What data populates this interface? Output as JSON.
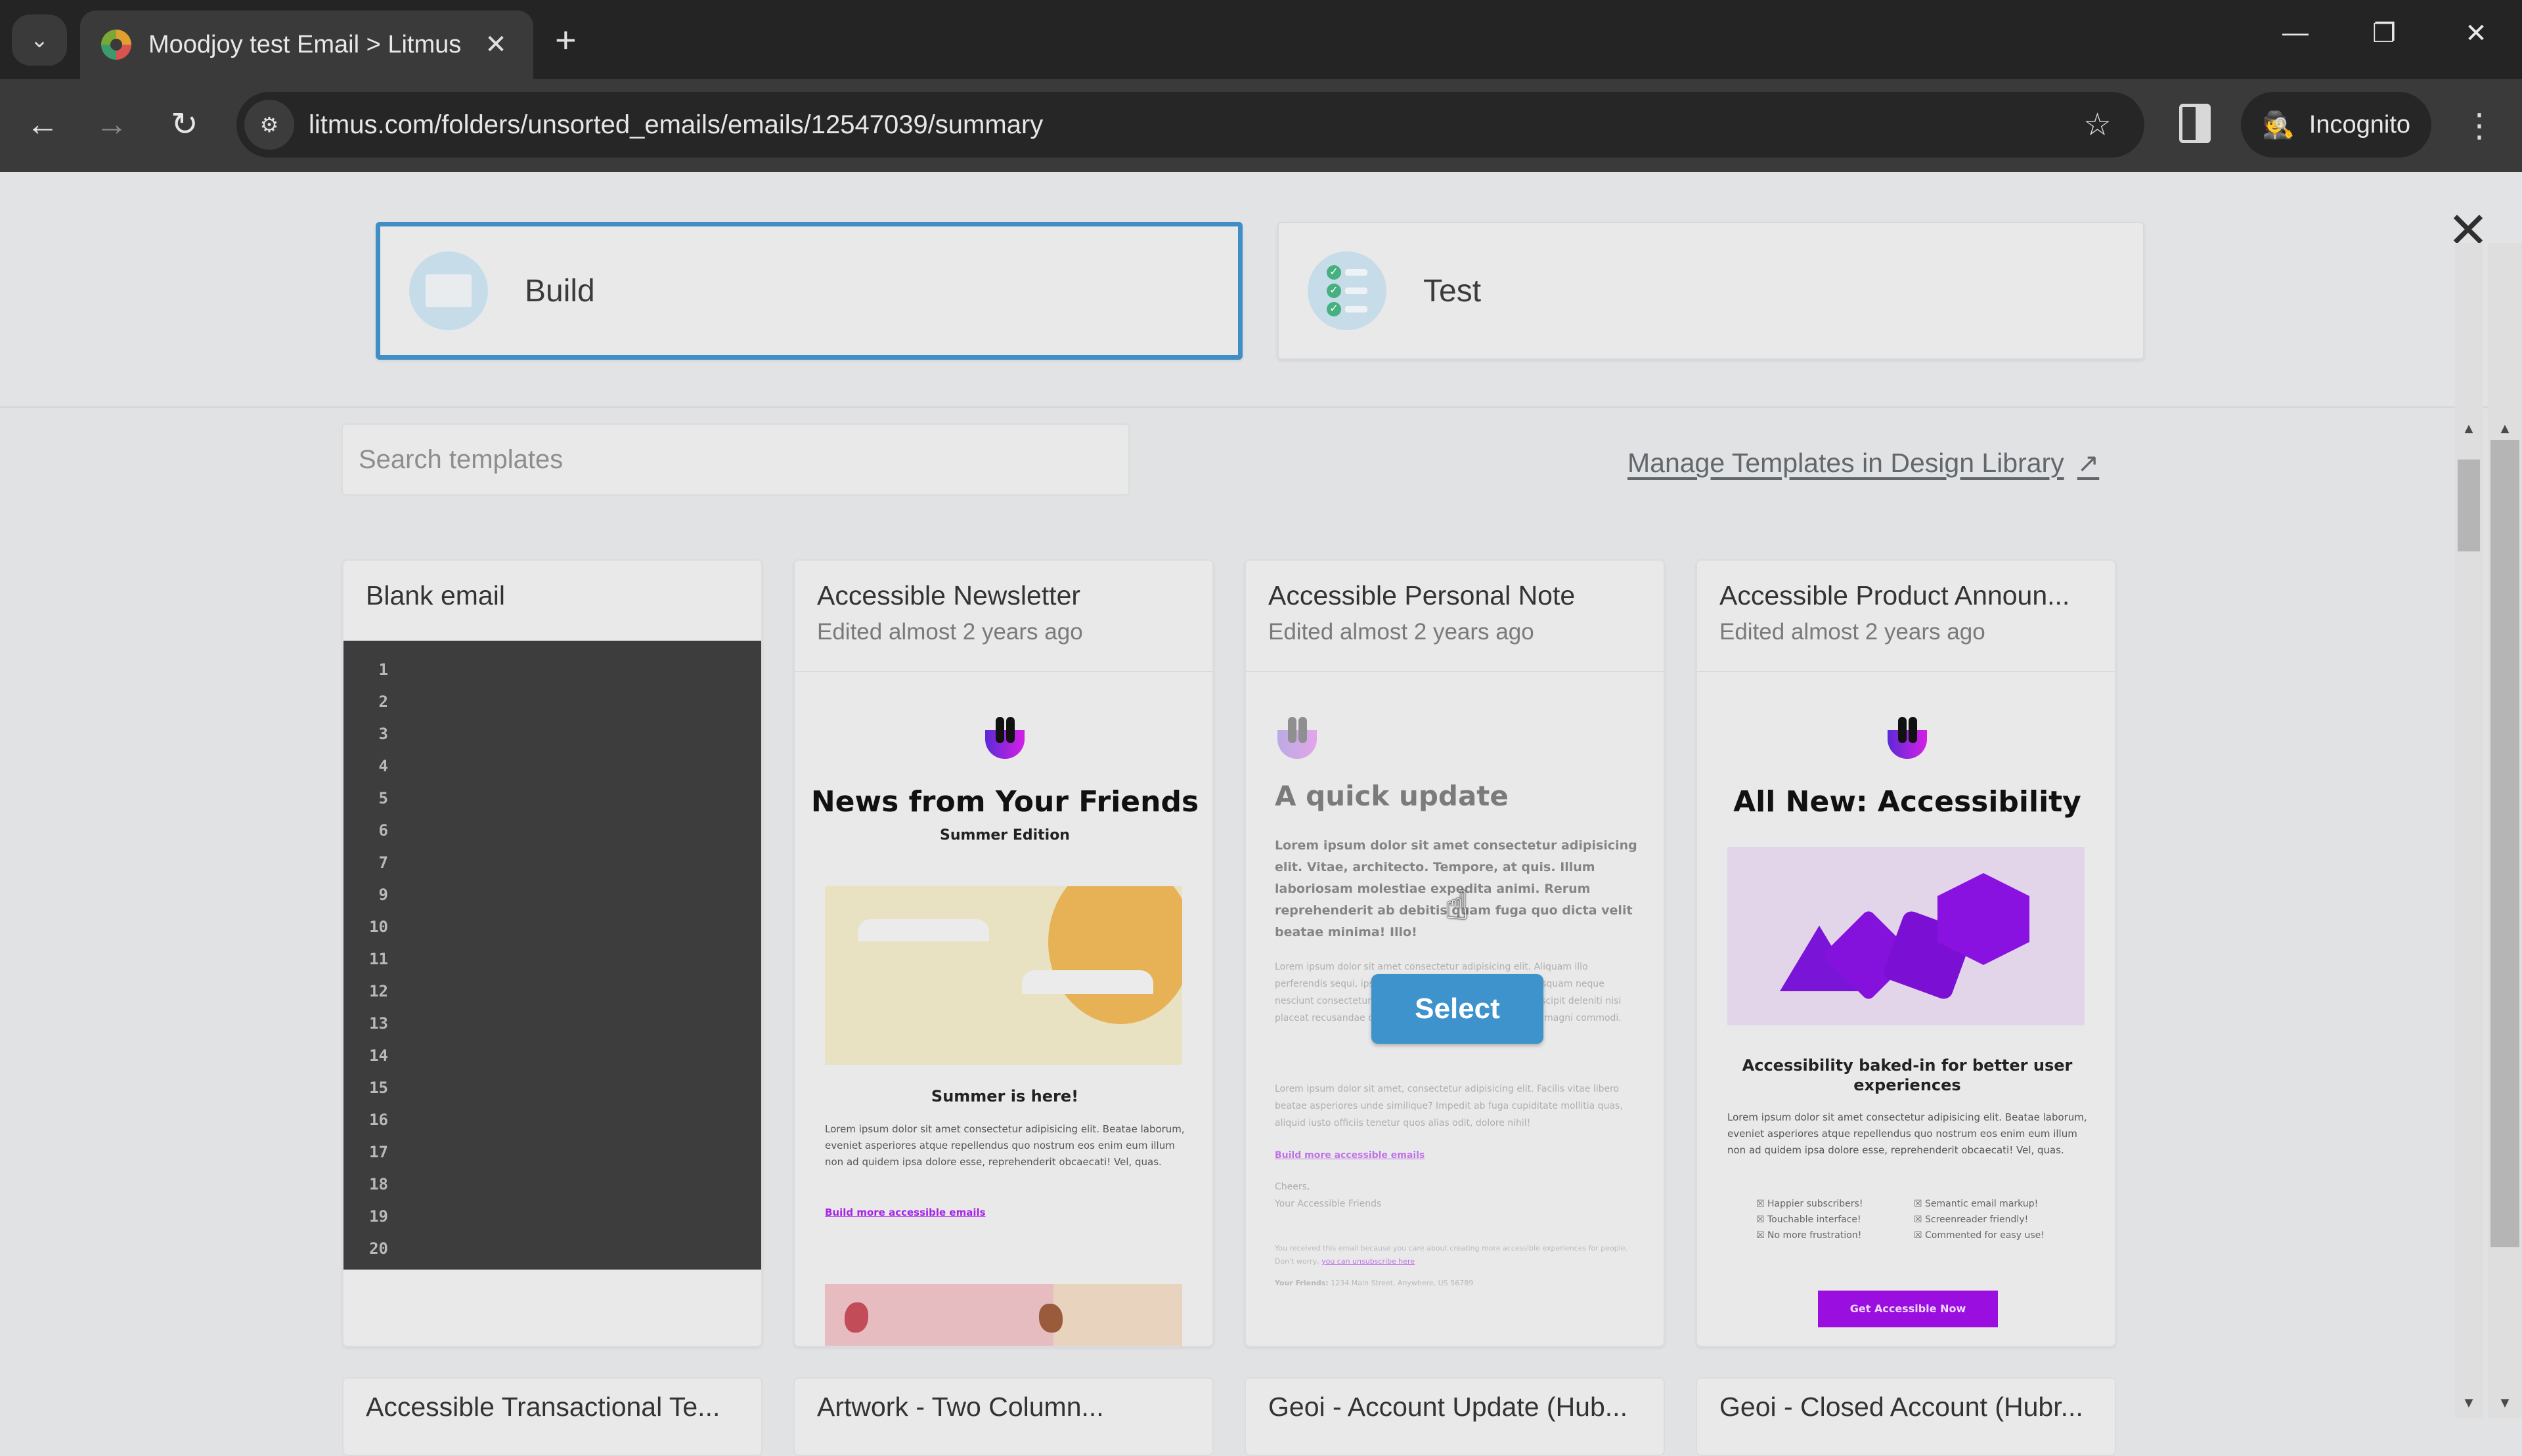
{
  "browser": {
    "tab_title": "Moodjoy test Email > Litmus",
    "url": "litmus.com/folders/unsorted_emails/emails/12547039/summary",
    "incognito_label": "Incognito",
    "icons": {
      "tab_search": "chevron-down-icon",
      "tab_close": "close-icon",
      "new_tab": "plus-icon",
      "back": "arrow-left-icon",
      "forward": "arrow-right-icon",
      "reload": "reload-icon",
      "site_info": "tune-icon",
      "bookmark": "star-icon",
      "side_panel": "side-panel-icon",
      "incognito": "incognito-icon",
      "menu": "kebab-menu-icon",
      "minimize": "minimize-icon",
      "restore": "restore-icon",
      "close": "close-icon"
    },
    "glyphs": {
      "tab_search": "⌄",
      "tab_close": "✕",
      "new_tab": "+",
      "back": "←",
      "forward": "→",
      "reload": "↻",
      "site_info": "⚙",
      "bookmark": "☆",
      "incognito": "🕵",
      "menu": "⋮",
      "minimize": "—",
      "restore": "❐",
      "close": "✕"
    }
  },
  "modal": {
    "modes": [
      {
        "label": "Build",
        "icon": "envelope-icon",
        "selected": true
      },
      {
        "label": "Test",
        "icon": "checklist-icon",
        "selected": false
      }
    ],
    "close_glyph": "✕",
    "search": {
      "placeholder": "Search templates",
      "value": ""
    },
    "manage_link": {
      "label": "Manage Templates in Design Library",
      "icon": "external-link-icon",
      "glyph": "↗"
    },
    "select_label": "Select",
    "accent_color": "#3f8fc6"
  },
  "templates": [
    {
      "title": "Blank email",
      "subtitle": "",
      "line_numbers": [
        "1",
        "2",
        "3",
        "4",
        "5",
        "6",
        "7",
        "9",
        "10",
        "11",
        "12",
        "13",
        "14",
        "15",
        "16",
        "17",
        "18",
        "19",
        "20"
      ]
    },
    {
      "title": "Accessible Newsletter",
      "subtitle": "Edited almost 2 years ago",
      "preview": {
        "heading": "News from Your Friends",
        "subheading": "Summer Edition",
        "section_heading": "Summer is here!",
        "body": "Lorem ipsum dolor sit amet consectetur adipisicing elit. Beatae laborum, eveniet asperiores atque repellendus quo nostrum eos enim eum illum non ad quidem ipsa dolore esse, reprehenderit obcaecati! Vel, quas.",
        "link": "Build more accessible emails"
      }
    },
    {
      "title": "Accessible Personal Note",
      "subtitle": "Edited almost 2 years ago",
      "hovered": true,
      "preview": {
        "heading": "A quick update",
        "lead": "Lorem ipsum dolor sit amet consectetur adipisicing elit. Vitae, architecto. Tempore, at quis. Illum laboriosam molestiae expedita animi. Rerum reprehenderit ab debitis quam fuga quo dicta velit beatae minima! Illo!",
        "body1": "Lorem ipsum dolor sit amet consectetur adipisicing elit. Aliquam illo perferendis sequi, ipsa distinctio ex vero, voluptatibus quisquam neque nesciunt consectetur adipisicing elit. Ullam accusamus suscipit deleniti nisi placeat recusandae consequatur voluptatibus perspiciatis magni commodi.",
        "body2": "Lorem ipsum dolor sit amet, consectetur adipisicing elit. Facilis vitae libero beatae asperiores unde similique? Impedit ab fuga cupiditate mollitia quas, aliquid iusto officiis tenetur quos alias odit, dolore nihil!",
        "link": "Build more accessible emails",
        "signoff": "Cheers,",
        "signature": "Your Accessible Friends",
        "footer": "You received this email because you care about creating more accessible experiences for people. Don't worry,",
        "unsubscribe": "you can unsubscribe here",
        "address_label": "Your Friends:",
        "address": "1234 Main Street, Anywhere, US 56789"
      }
    },
    {
      "title": "Accessible Product Announ...",
      "subtitle": "Edited almost 2 years ago",
      "preview": {
        "heading": "All New: Accessibility",
        "section_heading": "Accessibility baked-in for better user experiences",
        "body": "Lorem ipsum dolor sit amet consectetur adipisicing elit. Beatae laborum, eveniet asperiores atque repellendus quo nostrum eos enim eum illum non ad quidem ipsa dolore esse, reprehenderit obcaecati! Vel, quas.",
        "features": [
          "Happier subscribers!",
          "Semantic email markup!",
          "Touchable interface!",
          "Screenreader friendly!",
          "No more frustration!",
          "Commented for easy use!"
        ],
        "cta": "Get Accessible Now",
        "cta_color": "#9a0ee0"
      }
    }
  ],
  "next_row_titles": [
    "Accessible Transactional Te...",
    "Artwork - Two Column...",
    "Geoi - Account Update (Hub...",
    "Geoi - Closed Account (Hubr..."
  ]
}
